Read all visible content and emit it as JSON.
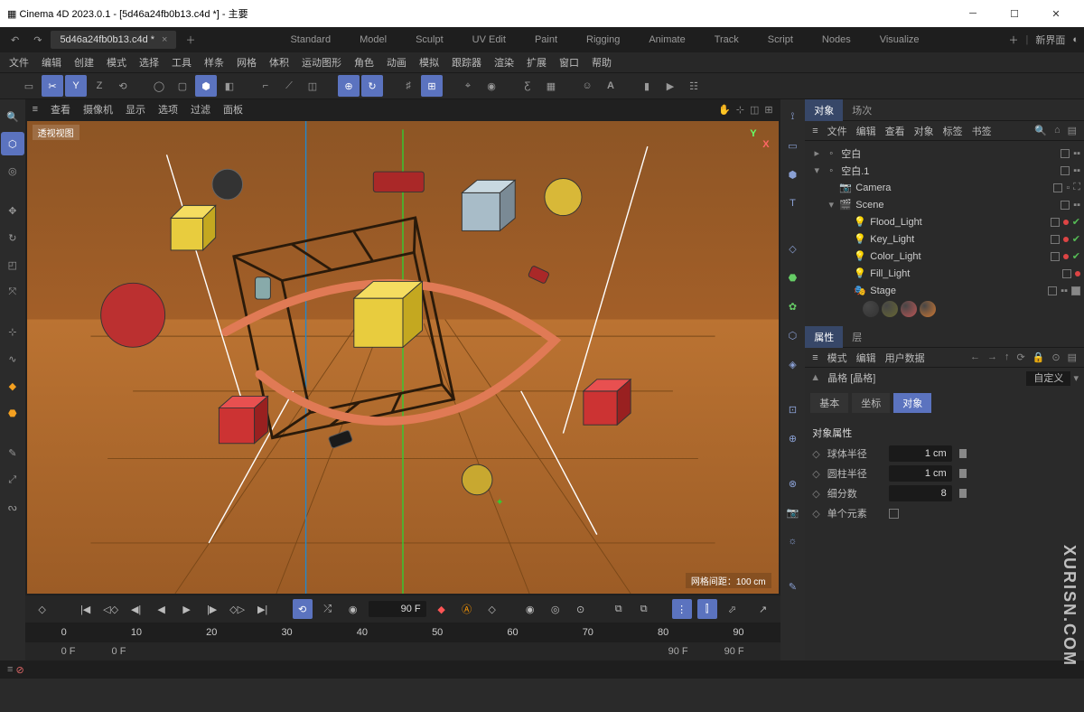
{
  "title": "Cinema 4D 2023.0.1 - [5d46a24fb0b13.c4d *] - 主要",
  "tab": {
    "name": "5d46a24fb0b13.c4d *"
  },
  "layouts": [
    "Standard",
    "Model",
    "Sculpt",
    "UV Edit",
    "Paint",
    "Rigging",
    "Animate",
    "Track",
    "Script",
    "Nodes",
    "Visualize"
  ],
  "layout_label": "新界面",
  "menu": [
    "文件",
    "编辑",
    "创建",
    "模式",
    "选择",
    "工具",
    "样条",
    "网格",
    "体积",
    "运动图形",
    "角色",
    "动画",
    "模拟",
    "跟踪器",
    "渲染",
    "扩展",
    "窗口",
    "帮助"
  ],
  "vp_menu": [
    "查看",
    "摄像机",
    "显示",
    "选项",
    "过滤",
    "面板"
  ],
  "vp_label": "透视视图",
  "grid_label": "网格间距：100 cm",
  "axes": {
    "y": "Y",
    "x": "X"
  },
  "timeline": {
    "frame": "90 F",
    "marks": [
      "0",
      "10",
      "20",
      "30",
      "40",
      "50",
      "60",
      "70",
      "80",
      "90"
    ],
    "range": [
      "0 F",
      "0 F",
      "90 F",
      "90 F"
    ]
  },
  "panels": {
    "object_tabs": [
      "对象",
      "场次"
    ],
    "object_header": [
      "文件",
      "编辑",
      "查看",
      "对象",
      "标签",
      "书签"
    ],
    "tree": [
      {
        "ind": 0,
        "tw": "▸",
        "ic": "◦",
        "name": "空白",
        "color": "#bbb",
        "st": [
          "box",
          "dd"
        ]
      },
      {
        "ind": 0,
        "tw": "▾",
        "ic": "◦",
        "name": "空白.1",
        "color": "#bbb",
        "st": [
          "box",
          "dd"
        ]
      },
      {
        "ind": 1,
        "tw": "",
        "ic": "📷",
        "name": "Camera",
        "color": "#d28a3a",
        "st": [
          "box",
          "sq",
          "tg"
        ]
      },
      {
        "ind": 1,
        "tw": "▾",
        "ic": "🎬",
        "name": "Scene",
        "color": "#d28a3a",
        "st": [
          "box",
          "dd"
        ]
      },
      {
        "ind": 2,
        "tw": "",
        "ic": "💡",
        "name": "Flood_Light",
        "color": "#cc8",
        "st": [
          "box",
          "dot-r",
          "chk"
        ]
      },
      {
        "ind": 2,
        "tw": "",
        "ic": "💡",
        "name": "Key_Light",
        "color": "#cc8",
        "st": [
          "box",
          "dot-r",
          "chk"
        ]
      },
      {
        "ind": 2,
        "tw": "",
        "ic": "💡",
        "name": "Color_Light",
        "color": "#cc8",
        "st": [
          "box",
          "dot-r",
          "chk"
        ]
      },
      {
        "ind": 2,
        "tw": "",
        "ic": "💡",
        "name": "Fill_Light",
        "color": "#cc8",
        "st": [
          "box",
          "dot-r"
        ]
      },
      {
        "ind": 2,
        "tw": "",
        "ic": "🎭",
        "name": "Stage",
        "color": "#6aa0e0",
        "st": [
          "box",
          "dd",
          "mats"
        ]
      }
    ],
    "attr_tabs": [
      "属性",
      "层"
    ],
    "attr_header": [
      "模式",
      "编辑",
      "用户数据"
    ],
    "attr_title": "晶格 [晶格]",
    "attr_mode": "自定义",
    "attr_sub": [
      "基本",
      "坐标",
      "对象"
    ],
    "props_title": "对象属性",
    "props": [
      {
        "label": "球体半径",
        "value": "1 cm",
        "slider": true
      },
      {
        "label": "圆柱半径",
        "value": "1 cm",
        "slider": true
      },
      {
        "label": "细分数",
        "value": "8",
        "slider": true
      },
      {
        "label": "单个元素",
        "checkbox": true
      }
    ]
  },
  "watermark": "XURISN.COM"
}
